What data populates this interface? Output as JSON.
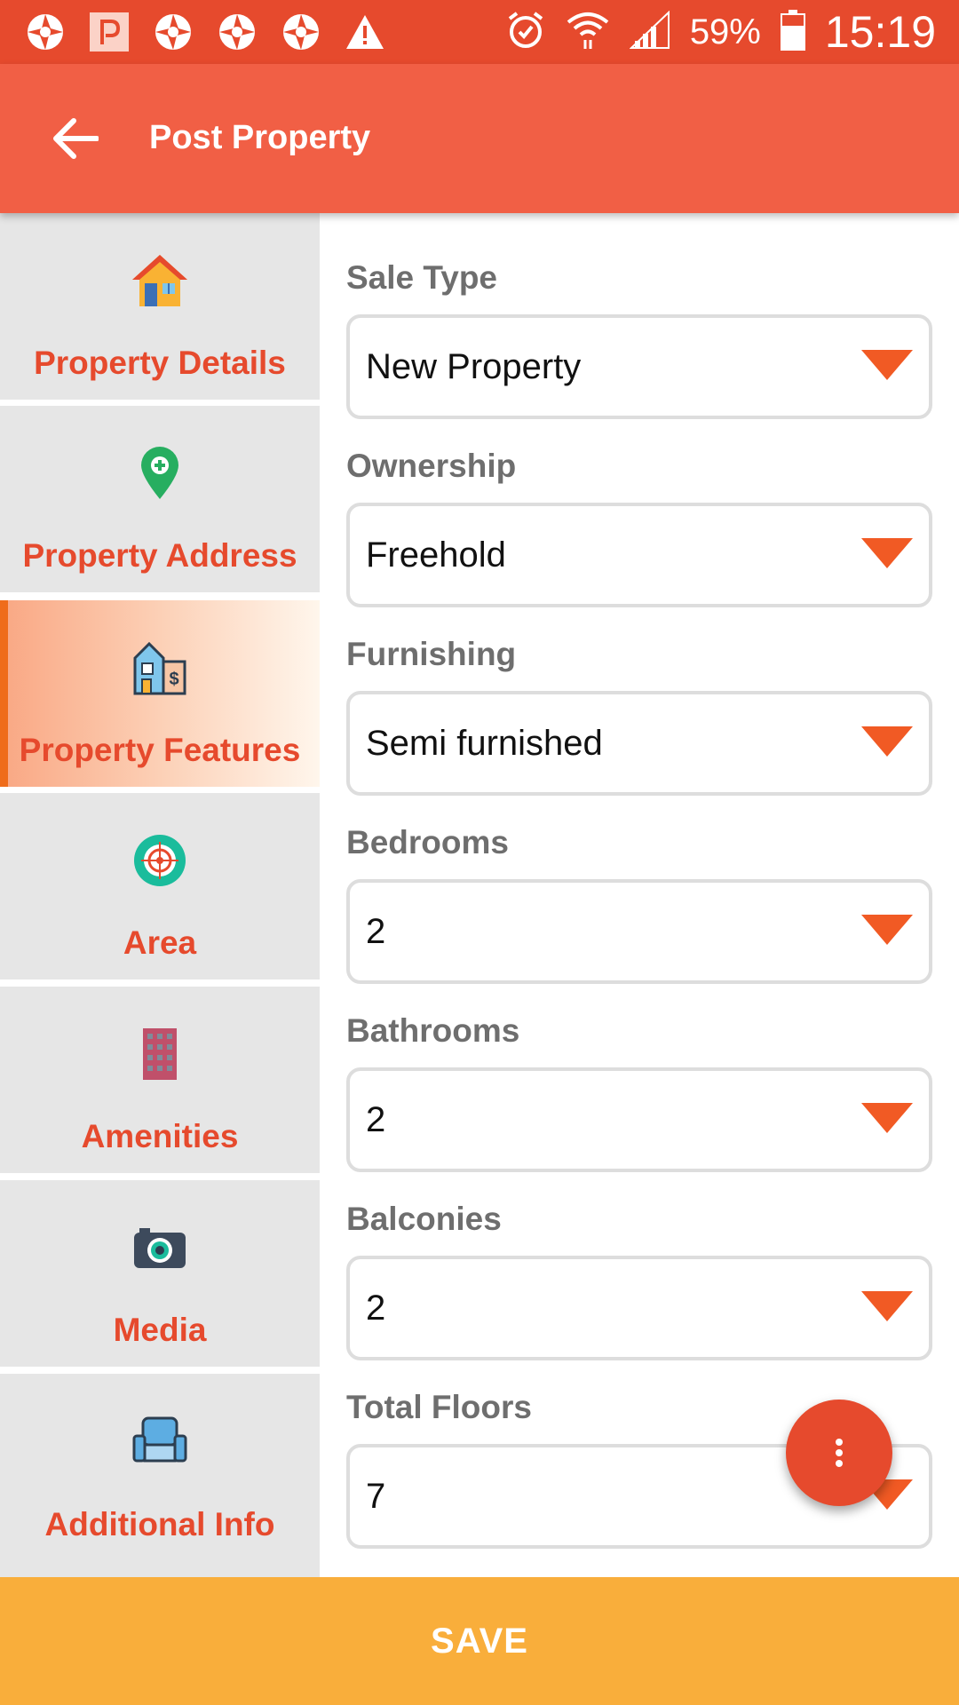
{
  "status_bar": {
    "battery_percent": "59%",
    "time": "15:19",
    "left_icons": [
      "aperture-icon",
      "p-badge-icon",
      "aperture-icon",
      "aperture-icon",
      "aperture-icon",
      "warning-icon"
    ],
    "right_icons": [
      "alarm-icon",
      "wifi-icon",
      "signal-icon",
      "battery-icon"
    ]
  },
  "app_bar": {
    "title": "Post Property",
    "back_icon": "arrow-left-icon"
  },
  "sidebar": {
    "items": [
      {
        "label": "Property Details",
        "icon": "house-icon",
        "active": false
      },
      {
        "label": "Property Address",
        "icon": "location-pin-plus-icon",
        "active": false
      },
      {
        "label": "Property Features",
        "icon": "building-price-icon",
        "active": true
      },
      {
        "label": "Area",
        "icon": "target-icon",
        "active": false
      },
      {
        "label": "Amenities",
        "icon": "apartment-building-icon",
        "active": false
      },
      {
        "label": "Media",
        "icon": "camera-icon",
        "active": false
      },
      {
        "label": "Additional Info",
        "icon": "armchair-icon",
        "active": false
      }
    ]
  },
  "form": {
    "fields": [
      {
        "label": "Sale Type",
        "value": "New Property"
      },
      {
        "label": "Ownership",
        "value": "Freehold"
      },
      {
        "label": "Furnishing",
        "value": "Semi furnished"
      },
      {
        "label": "Bedrooms",
        "value": "2"
      },
      {
        "label": "Bathrooms",
        "value": "2"
      },
      {
        "label": "Balconies",
        "value": "2"
      },
      {
        "label": "Total Floors",
        "value": "7"
      }
    ]
  },
  "fab": {
    "icon": "more-vertical-icon"
  },
  "save_button": {
    "label": "SAVE"
  },
  "colors": {
    "status_bar": "#e64a2d",
    "app_bar": "#f15f45",
    "accent": "#e64a2d",
    "save": "#f9ae3b",
    "sidebar_bg": "#e6e6e6"
  }
}
